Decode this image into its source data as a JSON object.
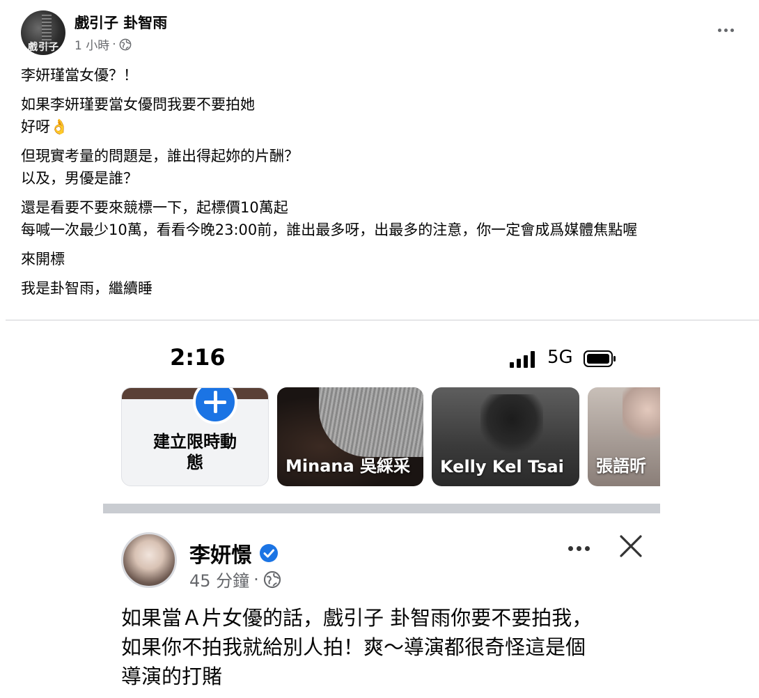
{
  "post": {
    "author": "戲引子 卦智雨",
    "avatar_text": "戲引子",
    "time": "1 小時",
    "meta_sep": "·",
    "paragraphs": [
      "李妍瑾當女優？！",
      "如果李妍瑾要當女優問我要不要拍她\n好呀👌",
      "但現實考量的問題是，誰出得起妳的片酬？\n以及，男優是誰？",
      "還是看要不要來競標一下，起標價10萬起\n每喊一次最少10萬，看看今晚23:00前，誰出最多呀，出最多的注意，你一定會成爲媒體焦點喔",
      "來開標",
      "我是卦智雨，繼續睡"
    ]
  },
  "embedded": {
    "status": {
      "time": "2:16",
      "network": "5G"
    },
    "stories": {
      "create_label": "建立限時動\n態",
      "items": [
        {
          "name": "Minana 吳綵采"
        },
        {
          "name": "Kelly Kel Tsai"
        },
        {
          "name": "張語昕"
        }
      ]
    },
    "inner_post": {
      "author": "李妍憬",
      "time": "45 分鐘",
      "meta_sep": "·",
      "text": "如果當Ａ片女優的話，戲引子 卦智雨你要不要拍我，\n如果你不拍我就給別人拍！爽～導演都很奇怪這是個\n導演的打賭"
    }
  },
  "colors": {
    "accent": "#1b74e4",
    "secondary_text": "#65676b",
    "divider": "#ced0d4"
  },
  "icons": [
    "globe-icon",
    "more-icon",
    "plus-icon",
    "verified-icon",
    "close-icon",
    "signal-icon",
    "battery-icon"
  ]
}
